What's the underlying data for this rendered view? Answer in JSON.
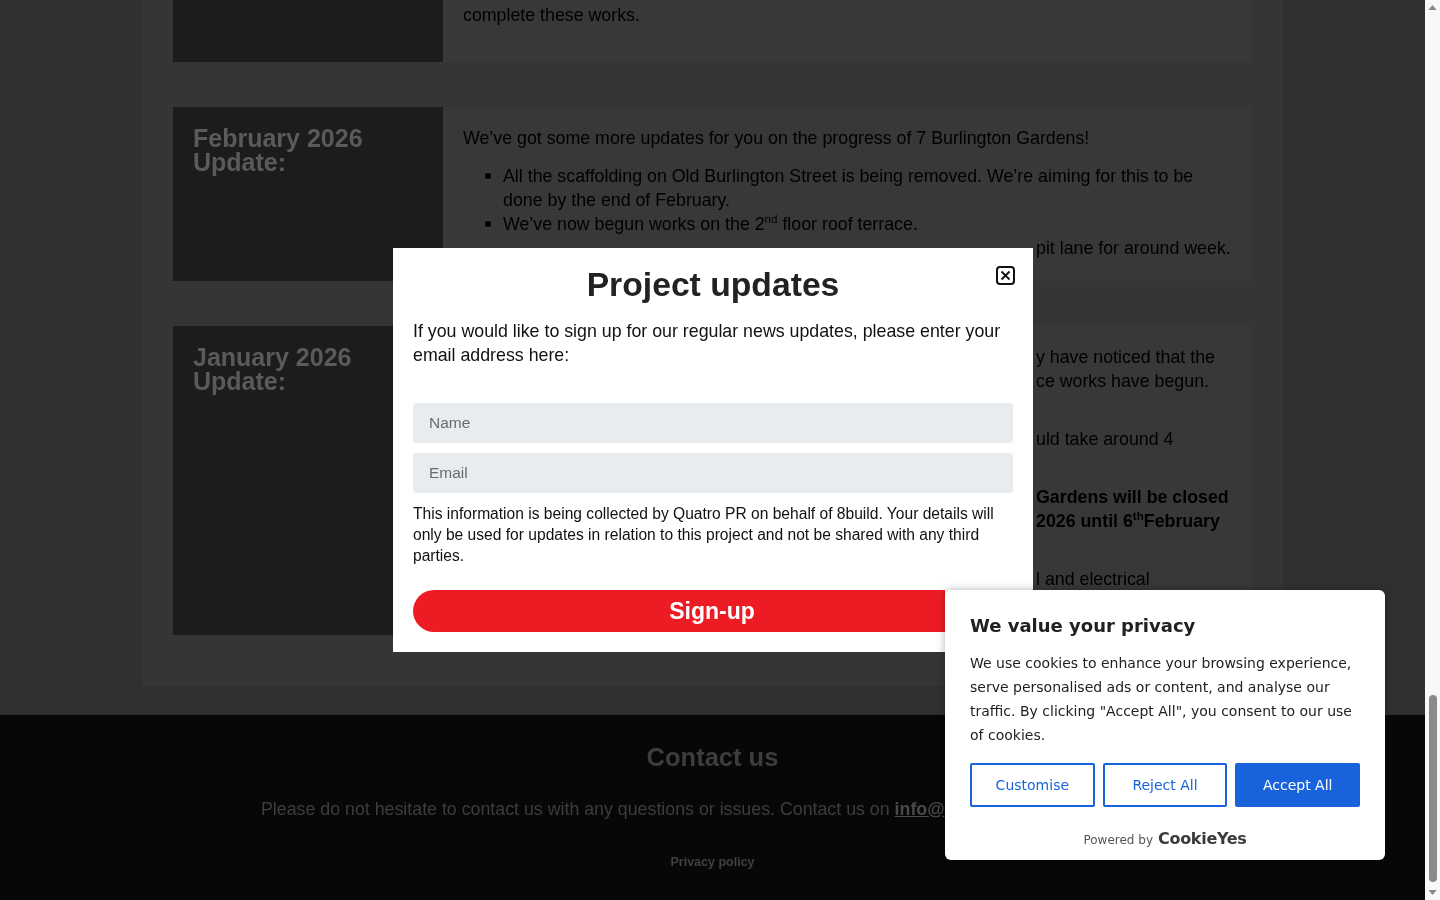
{
  "updates": [
    {
      "content": [
        {
          "kind": "paragraph",
          "text": "complete these works."
        }
      ]
    },
    {
      "title": "February 2026 Update:",
      "content": [
        {
          "kind": "paragraph",
          "text": "We’ve got some more updates for you on the progress of 7 Burlington Gardens!"
        },
        {
          "kind": "bullets",
          "items": [
            "All the scaffolding on Old Burlington Street is being removed. We’re aiming for this to be done by the end of February.",
            "We’ve now begun works on the 2$^{nd}$ floor roof terrace."
          ]
        },
        {
          "kind": "fragment",
          "bold": false,
          "lines": [
            "pit lane for around week."
          ]
        }
      ]
    },
    {
      "title": "January 2026 Update:",
      "content": [
        {
          "kind": "fragment",
          "bold": false,
          "lines": [
            "y have noticed that the",
            "ce works have begun."
          ]
        },
        {
          "kind": "fragment",
          "bold": false,
          "lines": [
            "uld take around 4"
          ]
        },
        {
          "kind": "fragment",
          "bold": true,
          "lines": [
            "Gardens will be closed",
            "2026 until 6$^{th}$February"
          ]
        },
        {
          "kind": "fragment",
          "bold": false,
          "lines": [
            "l and electrical"
          ]
        }
      ]
    }
  ],
  "footer": {
    "heading": "Contact us",
    "text": "Please do not hesitate to contact us with any questions or issues. Contact us on",
    "email_link": "info@",
    "privacy_link": "Privacy policy"
  },
  "modal": {
    "title": "Project updates",
    "intro": "If you would like to sign up for our regular news updates, please enter your email address here:",
    "fields": [
      {
        "placeholder": "Name"
      },
      {
        "placeholder": "Email"
      }
    ],
    "disclaimer": "This information is being collected by Quatro PR on behalf of 8build. Your details will only be used for updates in relation to this project and not be shared with any third parties.",
    "button": "Sign-up"
  },
  "cookie_banner": {
    "title": "We value your privacy",
    "text": "We use cookies to enhance your browsing experience, serve personalised ads or content, and analyse our traffic. By clicking \"Accept All\", you consent to our use of cookies.",
    "buttons": [
      {
        "label": "Customise",
        "kind": "outline"
      },
      {
        "label": "Reject All",
        "kind": "outline"
      },
      {
        "label": "Accept All",
        "kind": "filled"
      }
    ],
    "powered_by": "Powered by",
    "brand": "CookieYes"
  }
}
